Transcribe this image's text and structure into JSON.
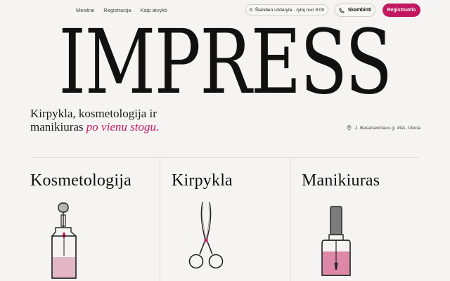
{
  "nav": {
    "items": [
      "Meistrai",
      "Registracija",
      "Kaip atvykti"
    ]
  },
  "header": {
    "status_text": "Šiandien uždaryta · rytoj nuo 9:00",
    "call_label": "Skambinti",
    "register_label": "Registruotis"
  },
  "brand": {
    "logo": "IMPRESS",
    "accent_color": "#c2185f"
  },
  "hero": {
    "tagline_line1": "Kirpykla, kosmetologija ir",
    "tagline_line2": "manikiuras",
    "tagline_accent": "po vienu stogu."
  },
  "address": "J. Basanavičiaus g. 49A, Utena",
  "categories": [
    {
      "title": "Kosmetologija",
      "icon": "serum-bottle-icon"
    },
    {
      "title": "Kirpykla",
      "icon": "scissors-icon"
    },
    {
      "title": "Manikiuras",
      "icon": "nail-polish-icon"
    }
  ]
}
